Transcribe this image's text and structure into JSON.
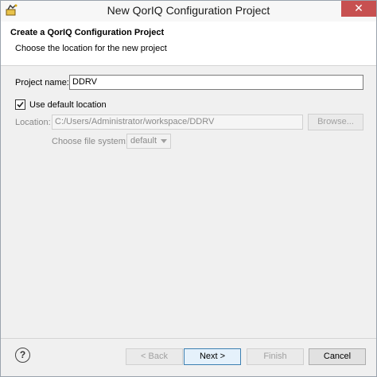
{
  "window": {
    "title": "New QorIQ Configuration Project",
    "close_glyph": "✕"
  },
  "header": {
    "title": "Create a QorIQ Configuration Project",
    "description": "Choose the location for the new project"
  },
  "form": {
    "project_name_label": "Project name:",
    "project_name_value": "DDRV",
    "use_default_label": "Use default location",
    "use_default_checked": true,
    "location_label": "Location:",
    "location_value": "C:/Users/Administrator/workspace/DDRV",
    "browse_label": "Browse...",
    "file_system_label": "Choose file system:",
    "file_system_value": "default"
  },
  "footer": {
    "help_glyph": "?",
    "back_label": "< Back",
    "next_label": "Next >",
    "finish_label": "Finish",
    "cancel_label": "Cancel"
  },
  "icons": {
    "app_icon": "eclipse-wizard-icon",
    "checkbox_check": "check-icon"
  }
}
